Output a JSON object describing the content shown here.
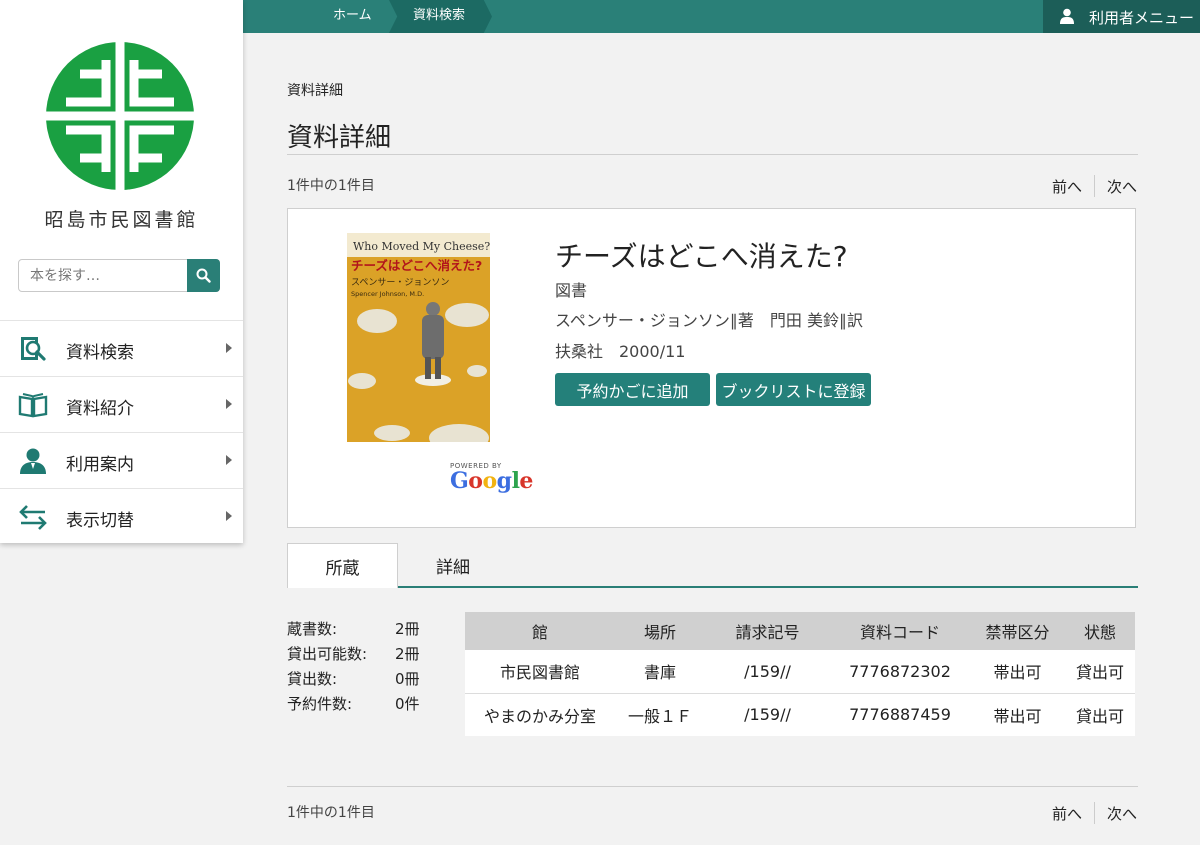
{
  "sidebar": {
    "library_name": "昭島市民図書館",
    "search_placeholder": "本を探す…",
    "items": [
      {
        "label": "資料検索",
        "icon": "book-search-icon"
      },
      {
        "label": "資料紹介",
        "icon": "open-book-icon"
      },
      {
        "label": "利用案内",
        "icon": "person-icon"
      },
      {
        "label": "表示切替",
        "icon": "swap-arrows-icon"
      }
    ]
  },
  "topbar": {
    "breadcrumb_home": "ホーム",
    "breadcrumb_current": "資料検索",
    "user_menu": "利用者メニュー"
  },
  "main": {
    "section_small": "資料詳細",
    "title": "資料詳細",
    "count_text": "1件中の1件目",
    "prev": "前へ",
    "next": "次へ"
  },
  "book": {
    "title": "チーズはどこへ消えた?",
    "type": "図書",
    "authors": "スペンサー・ジョンソン∥著　門田 美鈴∥訳",
    "publisher": "扶桑社　2000/11",
    "cover_text_en": "Who Moved My Cheese?",
    "cover_text_ja": "チーズはどこへ消えた?",
    "cover_author": "スペンサー・ジョンソン",
    "cover_author_en": "Spencer Johnson, M.D.",
    "powered_by": "POWERED BY",
    "google": "Google",
    "add_reserve": "予約かごに追加",
    "add_booklist": "ブックリストに登録"
  },
  "tabs": {
    "holdings": "所蔵",
    "details": "詳細"
  },
  "stats": [
    {
      "label": "蔵書数:",
      "value": "2冊"
    },
    {
      "label": "貸出可能数:",
      "value": "2冊"
    },
    {
      "label": "貸出数:",
      "value": "0冊"
    },
    {
      "label": "予約件数:",
      "value": "0件"
    }
  ],
  "holdings_table": {
    "headers": [
      "館",
      "場所",
      "請求記号",
      "資料コード",
      "禁帯区分",
      "状態"
    ],
    "rows": [
      [
        "市民図書館",
        "書庫",
        "/159//",
        "7776872302",
        "帯出可",
        "貸出可"
      ],
      [
        "やまのかみ分室",
        "一般１Ｆ",
        "/159//",
        "7776887459",
        "帯出可",
        "貸出可"
      ]
    ]
  },
  "colors": {
    "accent": "#2a8078",
    "accent_dark": "#1c5e58",
    "logo_green": "#1aa042"
  }
}
